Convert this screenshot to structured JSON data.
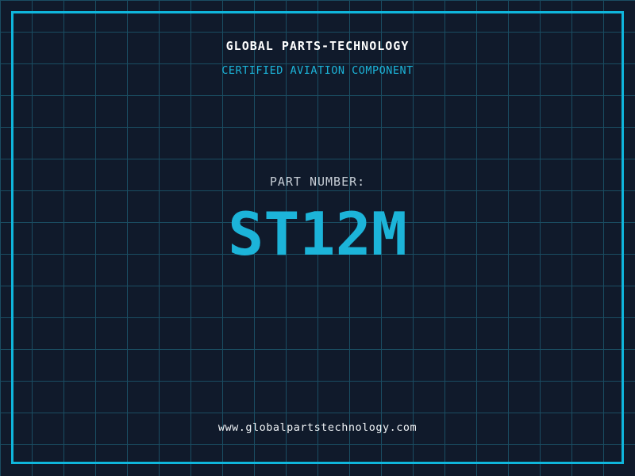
{
  "page": {
    "title": "GLOBAL PARTS-TECHNOLOGY",
    "subtitle": "CERTIFIED AVIATION COMPONENT",
    "part_label": "PART NUMBER:",
    "part_number": "ST12M",
    "website": "www.globalpartstechnology.com"
  },
  "colors": {
    "background": "#101a2b",
    "grid_line": "#1a4d62",
    "frame": "#0fb6dc",
    "accent_cyan": "#1cb4d9",
    "title_text": "#ffffff",
    "label_text": "#c6cdd5",
    "website_text": "#eef2f5"
  }
}
